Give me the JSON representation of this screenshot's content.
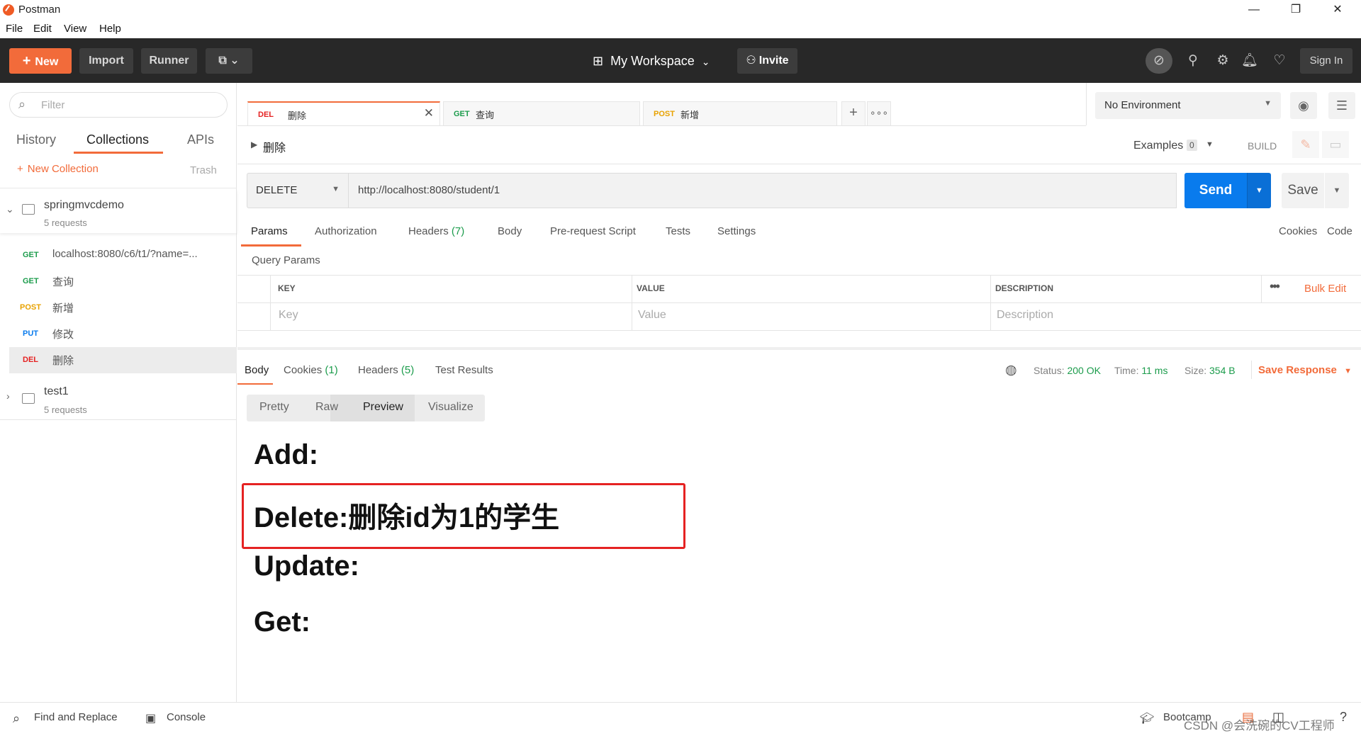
{
  "window": {
    "title": "Postman",
    "minimize": "—",
    "maximize": "❐",
    "close": "✕"
  },
  "menu": [
    "File",
    "Edit",
    "View",
    "Help"
  ],
  "header": {
    "new_label": "New",
    "import_label": "Import",
    "runner_label": "Runner",
    "workspace_label": "My Workspace",
    "invite_label": "Invite",
    "signin_label": "Sign In"
  },
  "sidebar": {
    "filter_placeholder": "Filter",
    "tabs": [
      "History",
      "Collections",
      "APIs"
    ],
    "new_collection": "New Collection",
    "trash": "Trash",
    "collections": [
      {
        "name": "springmvcdemo",
        "count": "5 requests",
        "requests": [
          {
            "method": "GET",
            "name": "localhost:8080/c6/t1/?name=..."
          },
          {
            "method": "GET",
            "name": "查询"
          },
          {
            "method": "POST",
            "name": "新增"
          },
          {
            "method": "PUT",
            "name": "修改"
          },
          {
            "method": "DEL",
            "name": "删除"
          }
        ]
      },
      {
        "name": "test1",
        "count": "5 requests"
      }
    ]
  },
  "tabs": [
    {
      "method": "DEL",
      "name": "删除"
    },
    {
      "method": "GET",
      "name": "查询"
    },
    {
      "method": "POST",
      "name": "新增"
    }
  ],
  "environment": {
    "selected": "No Environment"
  },
  "request": {
    "name": "删除",
    "examples_label": "Examples",
    "examples_count": "0",
    "build_label": "BUILD",
    "method": "DELETE",
    "url": "http://localhost:8080/student/1",
    "send_label": "Send",
    "save_label": "Save",
    "subtabs": [
      "Params",
      "Authorization",
      "Headers",
      "Body",
      "Pre-request Script",
      "Tests",
      "Settings"
    ],
    "headers_count": "(7)",
    "cookies_link": "Cookies",
    "code_link": "Code",
    "query_params_title": "Query Params",
    "columns": [
      "KEY",
      "VALUE",
      "DESCRIPTION"
    ],
    "bulk_edit": "Bulk Edit",
    "placeholders": {
      "key": "Key",
      "value": "Value",
      "description": "Description"
    }
  },
  "response": {
    "tabs": [
      "Body",
      "Cookies",
      "Headers",
      "Test Results"
    ],
    "cookies_count": "(1)",
    "headers_count": "(5)",
    "status_label": "Status:",
    "status_value": "200 OK",
    "time_label": "Time:",
    "time_value": "11 ms",
    "size_label": "Size:",
    "size_value": "354 B",
    "save_response": "Save Response",
    "formats": [
      "Pretty",
      "Raw",
      "Preview",
      "Visualize"
    ],
    "preview_lines": [
      "Add:",
      "Delete:删除id为1的学生",
      "Update:",
      "Get:"
    ]
  },
  "statusbar": {
    "find_replace": "Find and Replace",
    "console": "Console",
    "bootcamp": "Bootcamp",
    "watermark": "CSDN @会洗碗的CV工程师"
  },
  "colors": {
    "accent": "#f26b3a",
    "send": "#097bed",
    "header_bg": "#282828",
    "highlight_box": "#e52222"
  }
}
